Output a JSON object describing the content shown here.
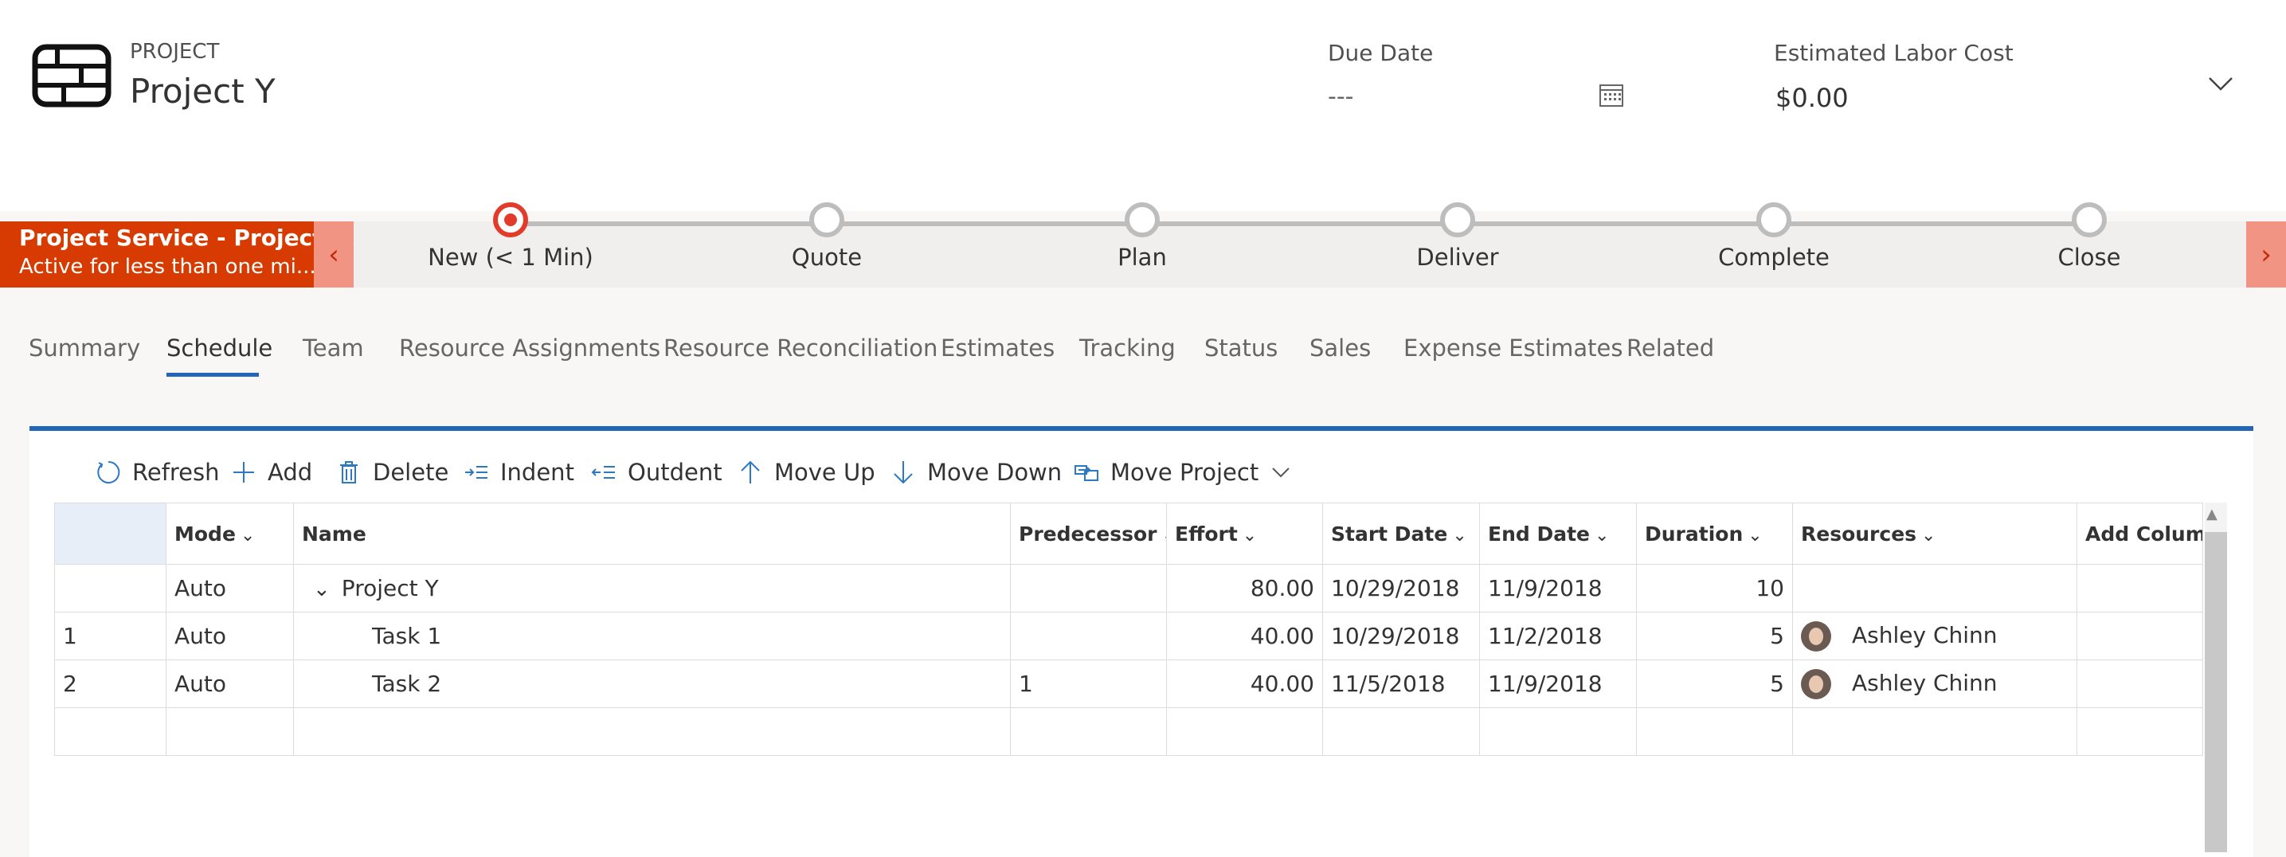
{
  "header": {
    "eyebrow": "PROJECT",
    "title": "Project Y",
    "due_label": "Due Date",
    "due_value": "---",
    "cost_label": "Estimated Labor Cost",
    "cost_value": "$0.00"
  },
  "bpf": {
    "card_title": "Project Service - Project ...",
    "card_sub": "Active for less than one mi...",
    "stages": [
      "New  (< 1 Min)",
      "Quote",
      "Plan",
      "Deliver",
      "Complete",
      "Close"
    ],
    "active_stage": "New",
    "accent": "#d83b01"
  },
  "tabs": [
    "Summary",
    "Schedule",
    "Team",
    "Resource Assignments",
    "Resource Reconciliation",
    "Estimates",
    "Tracking",
    "Status",
    "Sales",
    "Expense Estimates",
    "Related"
  ],
  "active_tab": "Schedule",
  "toolbar": {
    "refresh": "Refresh",
    "add": "Add",
    "delete": "Delete",
    "indent": "Indent",
    "outdent": "Outdent",
    "move_up": "Move Up",
    "move_down": "Move Down",
    "move_project": "Move Project"
  },
  "grid": {
    "columns": [
      "",
      "Mode",
      "Name",
      "Predecessor",
      "Effort",
      "Start Date",
      "End Date",
      "Duration",
      "Resources",
      "Add Column"
    ],
    "rows": [
      {
        "id": "",
        "mode": "Auto",
        "name": "Project Y",
        "pred": "",
        "effort": "80.00",
        "start": "10/29/2018",
        "end": "11/9/2018",
        "duration": "10",
        "resource": ""
      },
      {
        "id": "1",
        "mode": "Auto",
        "name": "Task 1",
        "pred": "",
        "effort": "40.00",
        "start": "10/29/2018",
        "end": "11/2/2018",
        "duration": "5",
        "resource": "Ashley Chinn"
      },
      {
        "id": "2",
        "mode": "Auto",
        "name": "Task 2",
        "pred": "1",
        "effort": "40.00",
        "start": "11/5/2018",
        "end": "11/9/2018",
        "duration": "5",
        "resource": "Ashley Chinn"
      }
    ]
  },
  "colors": {
    "accent_blue": "#2266b8",
    "accent_red": "#d83b01"
  }
}
